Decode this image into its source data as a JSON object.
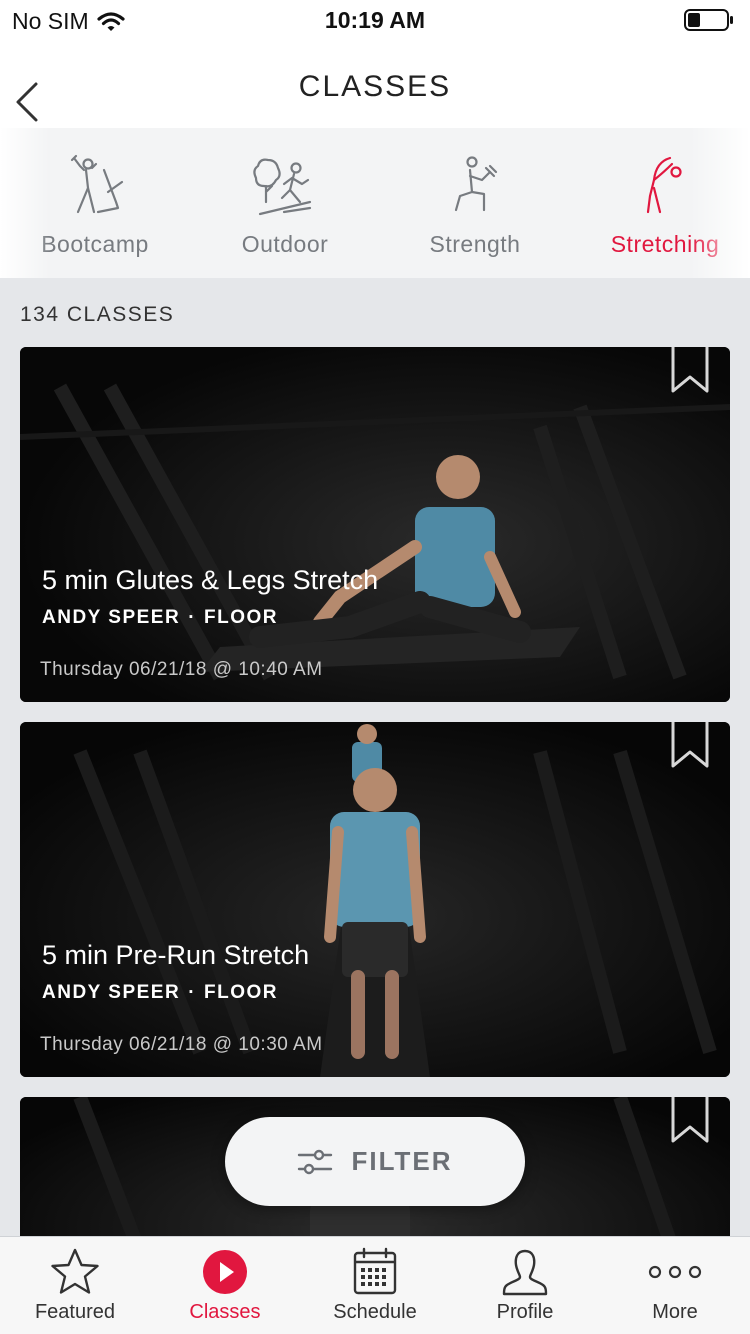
{
  "status_bar": {
    "carrier": "No SIM",
    "time": "10:19 AM",
    "wifi_icon": "wifi-icon",
    "battery_icon": "battery-icon"
  },
  "nav": {
    "title": "CLASSES",
    "back_icon": "chevron-left-icon"
  },
  "categories": [
    {
      "label": "Bootcamp",
      "icon": "bootcamp-icon",
      "active": false
    },
    {
      "label": "Outdoor",
      "icon": "outdoor-icon",
      "active": false
    },
    {
      "label": "Strength",
      "icon": "strength-icon",
      "active": false
    },
    {
      "label": "Stretching",
      "icon": "stretching-icon",
      "active": true
    }
  ],
  "class_count": "134 CLASSES",
  "classes": [
    {
      "title": "5 min Glutes & Legs Stretch",
      "instructor": "ANDY SPEER",
      "separator": "·",
      "type": "FLOOR",
      "date": "Thursday 06/21/18 @ 10:40 AM",
      "bookmark_icon": "bookmark-icon"
    },
    {
      "title": "5 min Pre-Run Stretch",
      "instructor": "ANDY SPEER",
      "separator": "·",
      "type": "FLOOR",
      "date": "Thursday 06/21/18 @ 10:30 AM",
      "bookmark_icon": "bookmark-icon"
    },
    {
      "bookmark_icon": "bookmark-icon"
    }
  ],
  "filter": {
    "label": "FILTER",
    "icon": "sliders-icon"
  },
  "tabs": [
    {
      "label": "Featured",
      "icon": "star-icon",
      "active": false
    },
    {
      "label": "Classes",
      "icon": "play-circle-icon",
      "active": true
    },
    {
      "label": "Schedule",
      "icon": "calendar-icon",
      "active": false
    },
    {
      "label": "Profile",
      "icon": "person-icon",
      "active": false
    },
    {
      "label": "More",
      "icon": "more-dots-icon",
      "active": false
    }
  ],
  "colors": {
    "accent": "#e1173f",
    "inactive_gray": "#777b80",
    "background": "#e5e7ea"
  }
}
